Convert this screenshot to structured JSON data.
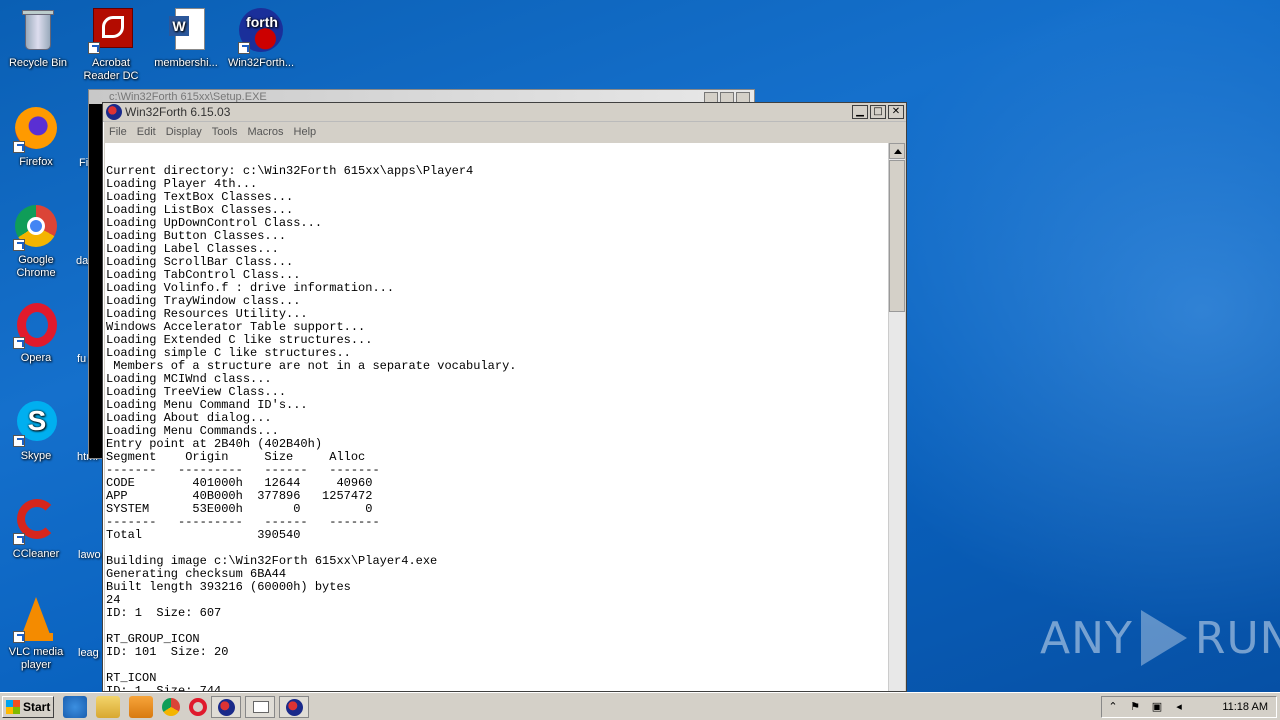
{
  "desktop": {
    "icons": [
      {
        "label": "Recycle Bin",
        "icon": "recycle-bin-icon"
      },
      {
        "label": "Acrobat Reader DC",
        "icon": "acrobat-icon"
      },
      {
        "label": "membershi...",
        "icon": "word-doc-icon"
      },
      {
        "label": "Win32Forth...",
        "icon": "forth-icon"
      },
      {
        "label": "Firefox",
        "icon": "firefox-icon"
      },
      {
        "label": "Google Chrome",
        "icon": "chrome-icon"
      },
      {
        "label": "Opera",
        "icon": "opera-icon"
      },
      {
        "label": "Skype",
        "icon": "skype-icon"
      },
      {
        "label": "CCleaner",
        "icon": "ccleaner-icon"
      },
      {
        "label": "VLC media player",
        "icon": "vlc-icon"
      }
    ],
    "partial_labels": [
      "Fi",
      "da",
      "fu",
      "html",
      "lawo",
      "leag"
    ]
  },
  "background_window": {
    "title": "c:\\Win32Forth 615xx\\Setup.EXE"
  },
  "window": {
    "title": "Win32Forth 6.15.03",
    "menu": [
      "File",
      "Edit",
      "Display",
      "Tools",
      "Macros",
      "Help"
    ],
    "console_lines": [
      "Current directory: c:\\Win32Forth 615xx\\apps\\Player4",
      "Loading Player 4th...",
      "Loading TextBox Classes...",
      "Loading ListBox Classes...",
      "Loading UpDownControl Class...",
      "Loading Button Classes...",
      "Loading Label Classes...",
      "Loading ScrollBar Class...",
      "Loading TabControl Class...",
      "Loading Volinfo.f : drive information...",
      "Loading TrayWindow class...",
      "Loading Resources Utility...",
      "Windows Accelerator Table support...",
      "Loading Extended C like structures...",
      "Loading simple C like structures..",
      " Members of a structure are not in a separate vocabulary.",
      "Loading MCIWnd class...",
      "Loading TreeView Class...",
      "Loading Menu Command ID's...",
      "Loading About dialog...",
      "Loading Menu Commands...",
      "Entry point at 2B40h (402B40h)",
      "Segment    Origin     Size     Alloc",
      "-------   ---------   ------   -------",
      "CODE        401000h   12644     40960",
      "APP         40B000h  377896   1257472",
      "SYSTEM      53E000h       0         0",
      "-------   ---------   ------   -------",
      "Total                390540",
      "",
      "Building image c:\\Win32Forth 615xx\\Player4.exe",
      "Generating checksum 6BA44",
      "Built length 393216 (60000h) bytes",
      "24",
      "ID: 1  Size: 607",
      "",
      "RT_GROUP_ICON",
      "ID: 101  Size: 20",
      "",
      "RT_ICON",
      "ID: 1  Size: 744"
    ]
  },
  "watermark": {
    "left": "ANY",
    "right": "RUN"
  },
  "taskbar": {
    "start_label": "Start",
    "clock": "11:18 AM"
  }
}
